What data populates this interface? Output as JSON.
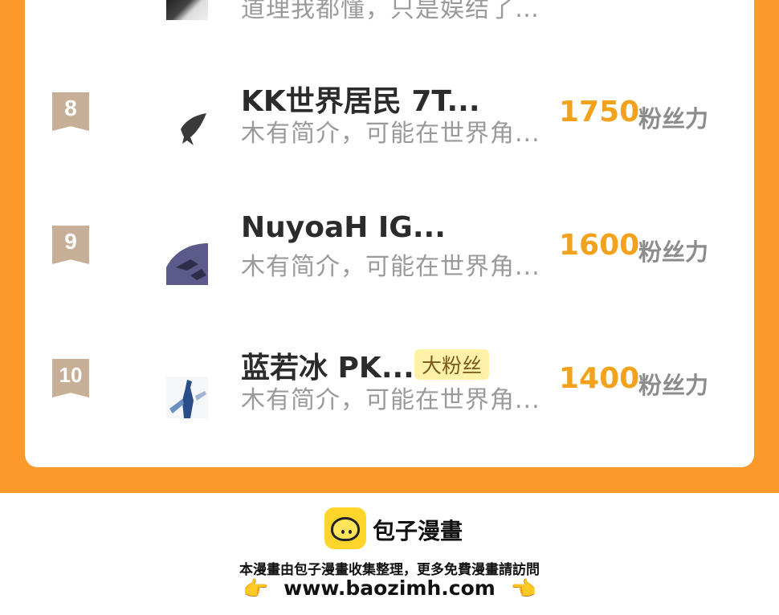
{
  "top_entry": {
    "desc": "道理我都懂，只是娱结了…"
  },
  "rankings": [
    {
      "rank": "8",
      "name": "KK世界居民  7T...",
      "desc": "木有简介，可能在世界角...",
      "score": "1750",
      "unit": "粉丝力",
      "badge": ""
    },
    {
      "rank": "9",
      "name": "NuyoaH  IG...",
      "desc": "木有简介，可能在世界角...",
      "score": "1600",
      "unit": "粉丝力",
      "badge": ""
    },
    {
      "rank": "10",
      "name": "蓝若冰  PK...",
      "desc": "木有简介，可能在世界角...",
      "score": "1400",
      "unit": "粉丝力",
      "badge": "大粉丝"
    }
  ],
  "footer": {
    "brand": "包子漫畫",
    "note": "本漫畫由包子漫畫收集整理，更多免費漫畫請訪問",
    "url": "www.baozimh.com",
    "left_hand": "👉",
    "right_hand": "👈"
  },
  "colors": {
    "accent_orange": "#fb9a2a",
    "score": "#f2a21c",
    "rank_badge": "#c7ae96"
  },
  "icons": [
    "fish-avatar-icon",
    "bun-logo-icon",
    "pointing-hand-icon"
  ]
}
